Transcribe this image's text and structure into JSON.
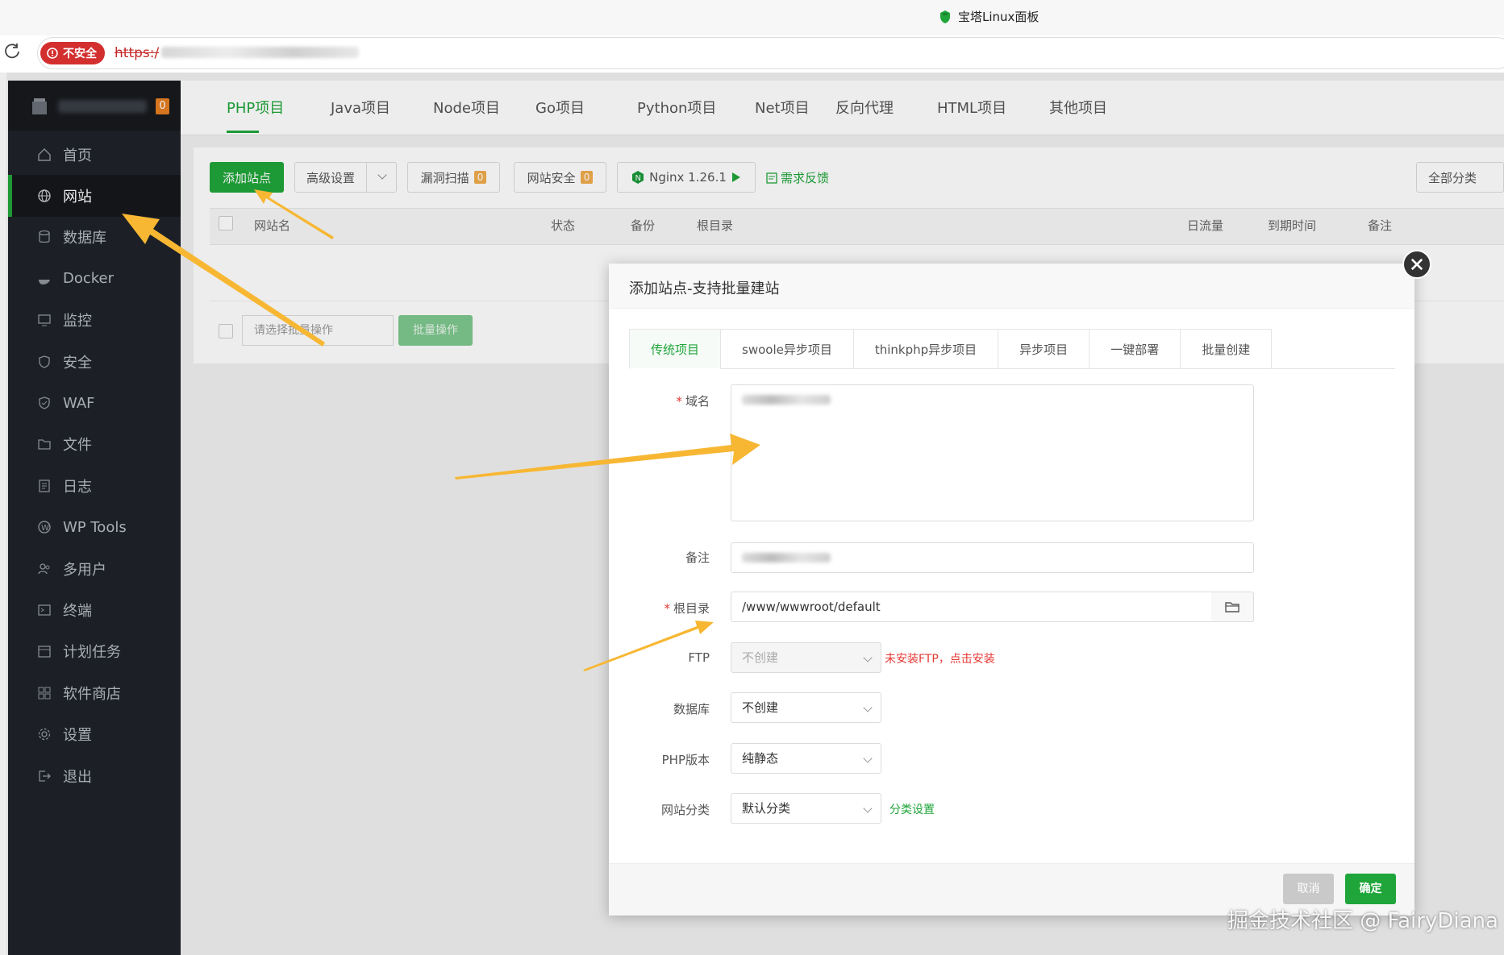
{
  "browser": {
    "tab_title": "宝塔Linux面板",
    "insecure_label": "不安全",
    "url_prefix": "https:/"
  },
  "sidebar": {
    "badge": "0",
    "items": [
      {
        "label": "首页",
        "icon": "home-icon"
      },
      {
        "label": "网站",
        "icon": "globe-icon",
        "active": true
      },
      {
        "label": "数据库",
        "icon": "database-icon"
      },
      {
        "label": "Docker",
        "icon": "docker-icon"
      },
      {
        "label": "监控",
        "icon": "monitor-icon"
      },
      {
        "label": "安全",
        "icon": "shield-icon"
      },
      {
        "label": "WAF",
        "icon": "waf-icon"
      },
      {
        "label": "文件",
        "icon": "folder-icon"
      },
      {
        "label": "日志",
        "icon": "log-icon"
      },
      {
        "label": "WP Tools",
        "icon": "wordpress-icon"
      },
      {
        "label": "多用户",
        "icon": "users-icon"
      },
      {
        "label": "终端",
        "icon": "terminal-icon"
      },
      {
        "label": "计划任务",
        "icon": "calendar-icon"
      },
      {
        "label": "软件商店",
        "icon": "apps-icon"
      },
      {
        "label": "设置",
        "icon": "gear-icon"
      },
      {
        "label": "退出",
        "icon": "logout-icon"
      }
    ]
  },
  "project_tabs": [
    "PHP项目",
    "Java项目",
    "Node项目",
    "Go项目",
    "Python项目",
    "Net项目",
    "反向代理",
    "HTML项目",
    "其他项目"
  ],
  "toolbar": {
    "add_site": "添加站点",
    "advanced": "高级设置",
    "vuln_scan": "漏洞扫描",
    "vuln_count": "0",
    "site_security": "网站安全",
    "security_count": "0",
    "nginx": "Nginx 1.26.1",
    "feedback": "需求反馈",
    "category": "全部分类"
  },
  "table": {
    "headers": {
      "site_name": "网站名",
      "status": "状态",
      "backup": "备份",
      "root": "根目录",
      "traffic": "日流量",
      "expire": "到期时间",
      "note": "备注"
    },
    "batch_placeholder": "请选择批量操作",
    "batch_button": "批量操作"
  },
  "modal": {
    "title": "添加站点-支持批量建站",
    "tabs": [
      "传统项目",
      "swoole异步项目",
      "thinkphp异步项目",
      "异步项目",
      "一键部署",
      "批量创建"
    ],
    "active_tab": 0,
    "fields": {
      "domain_label": "域名",
      "note_label": "备注",
      "root_label": "根目录",
      "root_value": "/www/wwwroot/default",
      "ftp_label": "FTP",
      "ftp_value": "不创建",
      "ftp_warning": "未安装FTP，点击安装",
      "db_label": "数据库",
      "db_value": "不创建",
      "php_label": "PHP版本",
      "php_value": "纯静态",
      "category_label": "网站分类",
      "category_value": "默认分类",
      "category_link": "分类设置"
    },
    "cancel": "取消",
    "confirm": "确定"
  },
  "watermark": "掘金技术社区 @ FairyDiana",
  "colors": {
    "brand_green": "#20a53a",
    "sidebar_bg": "#1f2329",
    "warning_red": "#e53935",
    "arrow": "#f7b733"
  }
}
